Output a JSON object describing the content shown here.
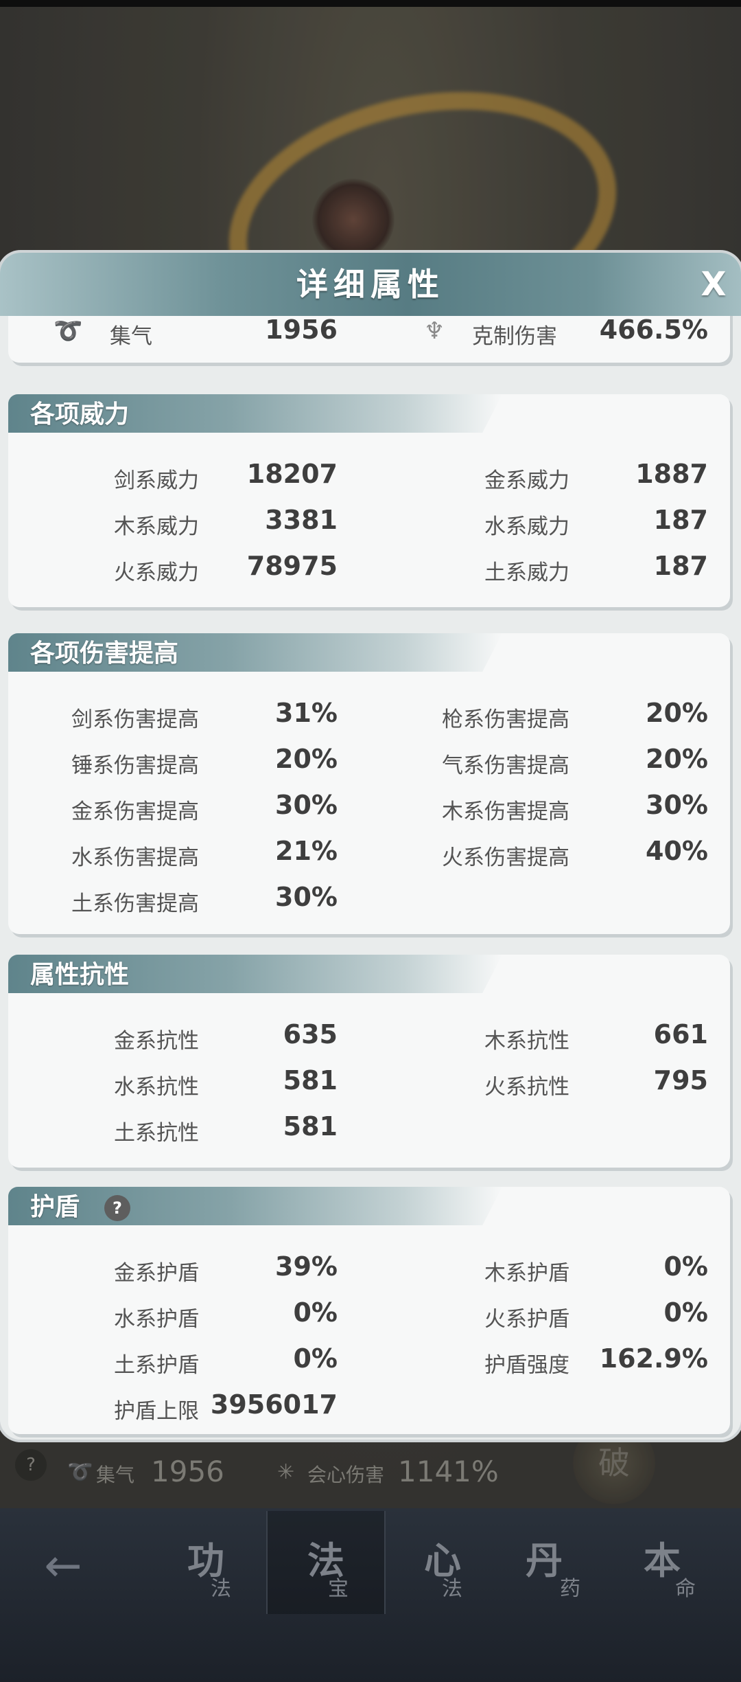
{
  "background": {
    "break_label": "破",
    "help_symbol": "?",
    "stat_icons": [
      "swirl-icon",
      "star-icon"
    ],
    "stats": [
      {
        "label": "集气",
        "value": "1956"
      },
      {
        "label": "会心伤害",
        "value": "1141%"
      }
    ]
  },
  "nav": {
    "back_symbol": "←",
    "tabs": [
      {
        "main": "功",
        "sub": "法"
      },
      {
        "main": "法",
        "sub": "宝",
        "active": true
      },
      {
        "main": "心",
        "sub": "法"
      },
      {
        "main": "丹",
        "sub": "药"
      },
      {
        "main": "本",
        "sub": "命"
      }
    ]
  },
  "modal": {
    "title": "详细属性",
    "close_symbol": "X",
    "top_row": {
      "left": {
        "icon": "swirl-icon",
        "label": "集气",
        "value": "1956"
      },
      "right": {
        "icon": "restraint-icon",
        "label": "克制伤害",
        "value": "466.5%"
      }
    },
    "sections": [
      {
        "title": "各项威力",
        "rows": [
          [
            {
              "label": "剑系威力",
              "value": "18207"
            },
            {
              "label": "金系威力",
              "value": "1887"
            }
          ],
          [
            {
              "label": "木系威力",
              "value": "3381"
            },
            {
              "label": "水系威力",
              "value": "187"
            }
          ],
          [
            {
              "label": "火系威力",
              "value": "78975"
            },
            {
              "label": "土系威力",
              "value": "187"
            }
          ]
        ]
      },
      {
        "title": "各项伤害提高",
        "rows": [
          [
            {
              "label": "剑系伤害提高",
              "value": "31%"
            },
            {
              "label": "枪系伤害提高",
              "value": "20%"
            }
          ],
          [
            {
              "label": "锤系伤害提高",
              "value": "20%"
            },
            {
              "label": "气系伤害提高",
              "value": "20%"
            }
          ],
          [
            {
              "label": "金系伤害提高",
              "value": "30%"
            },
            {
              "label": "木系伤害提高",
              "value": "30%"
            }
          ],
          [
            {
              "label": "水系伤害提高",
              "value": "21%"
            },
            {
              "label": "火系伤害提高",
              "value": "40%"
            }
          ],
          [
            {
              "label": "土系伤害提高",
              "value": "30%"
            }
          ]
        ]
      },
      {
        "title": "属性抗性",
        "rows": [
          [
            {
              "label": "金系抗性",
              "value": "635"
            },
            {
              "label": "木系抗性",
              "value": "661"
            }
          ],
          [
            {
              "label": "水系抗性",
              "value": "581"
            },
            {
              "label": "火系抗性",
              "value": "795"
            }
          ],
          [
            {
              "label": "土系抗性",
              "value": "581"
            }
          ]
        ]
      },
      {
        "title": "护盾",
        "help_symbol": "?",
        "rows": [
          [
            {
              "label": "金系护盾",
              "value": "39%"
            },
            {
              "label": "木系护盾",
              "value": "0%"
            }
          ],
          [
            {
              "label": "水系护盾",
              "value": "0%"
            },
            {
              "label": "火系护盾",
              "value": "0%"
            }
          ],
          [
            {
              "label": "土系护盾",
              "value": "0%"
            },
            {
              "label": "护盾强度",
              "value": "162.9%"
            }
          ],
          [
            {
              "label": "护盾上限",
              "value": "3956017"
            }
          ]
        ]
      }
    ]
  }
}
